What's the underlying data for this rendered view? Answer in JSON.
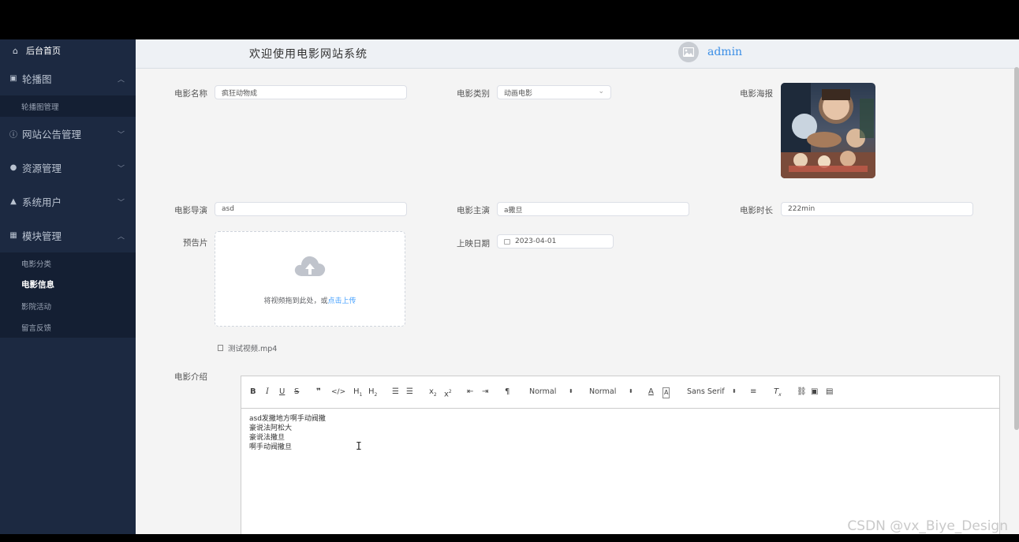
{
  "sidebar": {
    "home": "后台首页",
    "groups": [
      {
        "label": "轮播图",
        "icon": "image-icon",
        "expanded": true,
        "items": [
          "轮播图管理"
        ]
      },
      {
        "label": "网站公告管理",
        "icon": "info-icon",
        "expanded": false
      },
      {
        "label": "资源管理",
        "icon": "location-icon",
        "expanded": false
      },
      {
        "label": "系统用户",
        "icon": "user-icon",
        "expanded": false
      },
      {
        "label": "模块管理",
        "icon": "grid-icon",
        "expanded": true,
        "items": [
          "电影分类",
          "电影信息",
          "影院活动",
          "留言反馈"
        ]
      }
    ],
    "active_item": "电影信息"
  },
  "header": {
    "title": "欢迎使用电影网站系统",
    "username": "admin"
  },
  "form": {
    "name_label": "电影名称",
    "name_value": "疯狂动物成",
    "category_label": "电影类别",
    "category_value": "动画电影",
    "poster_label": "电影海报",
    "director_label": "电影导演",
    "director_value": "asd",
    "actor_label": "电影主演",
    "actor_value": "a撒旦",
    "duration_label": "电影时长",
    "duration_value": "222min",
    "trailer_label": "预告片",
    "upload_text": "将视频拖到此处，或",
    "upload_link": "点击上传",
    "file_name": "测试视频.mp4",
    "release_label": "上映日期",
    "release_value": "2023-04-01",
    "intro_label": "电影介绍"
  },
  "editor": {
    "toolbar": {
      "header_select": "Normal",
      "size_select": "Normal",
      "font_select": "Sans Serif"
    },
    "lines": [
      "asd发撒地方啊手动阀撒",
      "豪说法阿松大",
      "豪说法撒旦",
      "啊手动阀撒旦"
    ]
  },
  "watermark": "CSDN @vx_Biye_Design",
  "colors": {
    "sidebar_bg": "#1c2941",
    "accent": "#409eff",
    "header_bg": "#eef1f5"
  }
}
